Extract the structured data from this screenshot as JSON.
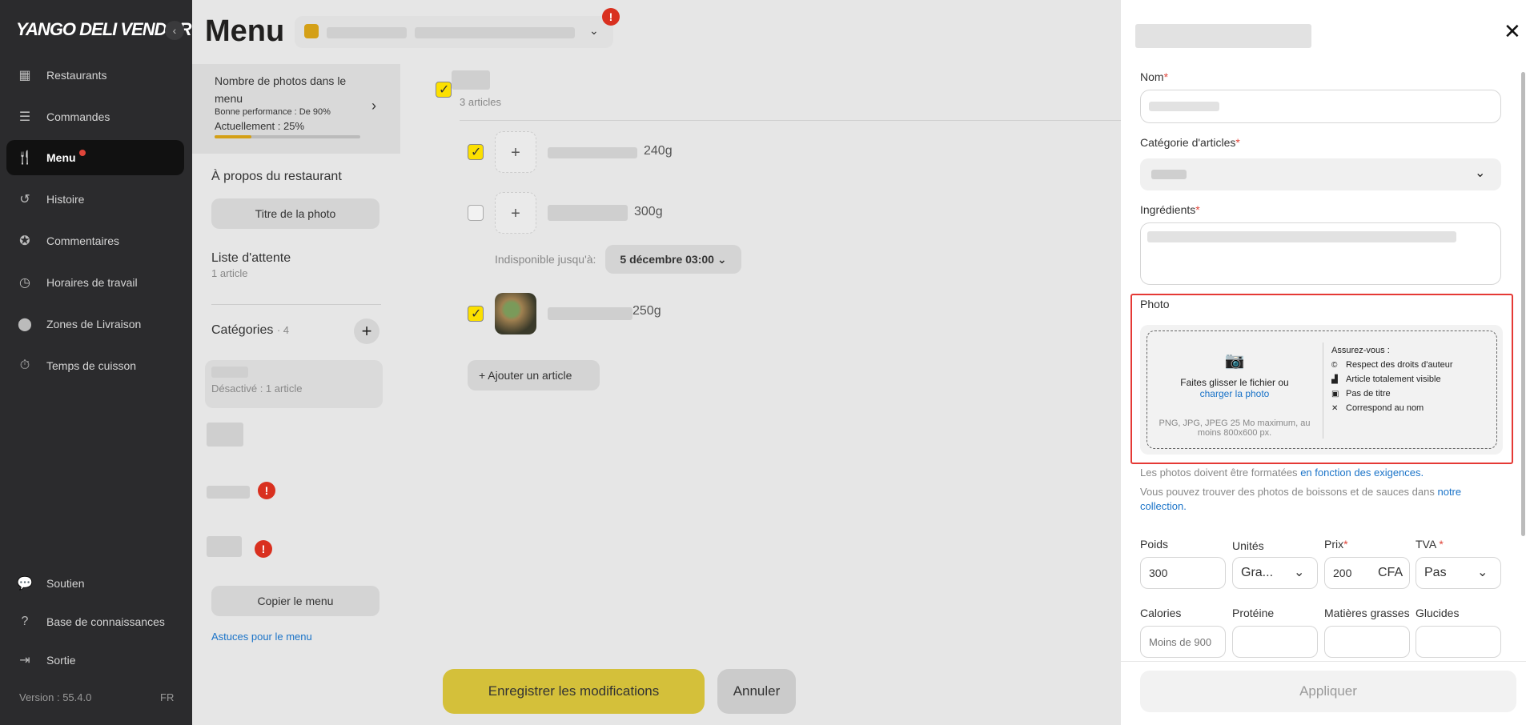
{
  "sidebar": {
    "logo": "YANGO DELI VENDOR",
    "collapse_icon": "‹",
    "items": [
      {
        "label": "Restaurants",
        "icon": "store-icon"
      },
      {
        "label": "Commandes",
        "icon": "list-icon"
      },
      {
        "label": "Menu",
        "icon": "fork-knife-icon"
      },
      {
        "label": "Histoire",
        "icon": "history-icon"
      },
      {
        "label": "Commentaires",
        "icon": "comment-icon"
      },
      {
        "label": "Horaires de travail",
        "icon": "clock-icon"
      },
      {
        "label": "Zones de Livraison",
        "icon": "pin-icon"
      },
      {
        "label": "Temps de cuisson",
        "icon": "timer-icon"
      },
      {
        "label": "Soutien",
        "icon": "chat-icon"
      },
      {
        "label": "Base de connaissances",
        "icon": "help-icon"
      },
      {
        "label": "Sortie",
        "icon": "logout-icon"
      }
    ],
    "version": "Version : 55.4.0",
    "lang": "FR"
  },
  "header": {
    "title": "Menu",
    "alert": "!"
  },
  "left_panel": {
    "photo_card": {
      "title": "Nombre de photos dans le menu",
      "subtitle": "Bonne performance : De 90%",
      "current": "Actuellement : 25%",
      "progress": 0.25
    },
    "about": "À propos du restaurant",
    "photo_title_btn": "Titre de la photo",
    "waitlist": "Liste d'attente",
    "waitlist_count": "1 article",
    "categories": "Catégories",
    "categories_count": "· 4",
    "disabled_note": "Désactivé : 1 article",
    "copy_menu": "Copier le menu",
    "tips": "Astuces pour le menu"
  },
  "middle": {
    "count": "3 articles",
    "items": [
      {
        "weight": "240g",
        "checked": true
      },
      {
        "weight": "300g",
        "checked": false
      },
      {
        "weight": "250g",
        "checked": true
      }
    ],
    "unavailable_label": "Indisponible jusqu'à:",
    "unavailable_date": "5 décembre 03:00",
    "add_item": "Ajouter un article",
    "save": "Enregistrer les modifications",
    "cancel": "Annuler"
  },
  "drawer": {
    "name_label": "Nom",
    "category_label": "Catégorie d'articles",
    "ingredients_label": "Ingrédients",
    "photo_label": "Photo",
    "drop_text": "Faites glisser le fichier ou",
    "drop_link": "charger la photo",
    "drop_formats": "PNG, JPG, JPEG 25 Mo maximum, au moins 800x600 px.",
    "assure_title": "Assurez-vous :",
    "assure_items": [
      {
        "text": "Respect des droits d'auteur",
        "icon": "copyright-icon"
      },
      {
        "text": "Article totalement visible",
        "icon": "dish-icon"
      },
      {
        "text": "Pas de titre",
        "icon": "image-icon"
      },
      {
        "text": "Correspond au nom",
        "icon": "utensils-icon"
      }
    ],
    "format_note": "Les photos doivent être formatées",
    "format_link": "en fonction des exigences.",
    "drinks_note": "Vous pouvez trouver des photos de boissons et de sauces dans",
    "drinks_link": "notre collection.",
    "weight_label": "Poids",
    "weight_value": "300",
    "units_label": "Unités",
    "units_value": "Gra...",
    "price_label": "Prix",
    "price_value": "200",
    "price_currency": "CFA",
    "vat_label": "TVA",
    "vat_value": "Pas",
    "calories_label": "Calories",
    "calories_placeholder": "Moins de 900",
    "protein_label": "Protéine",
    "fat_label": "Matières grasses",
    "carbs_label": "Glucides",
    "apply": "Appliquer",
    "close": "✕"
  }
}
